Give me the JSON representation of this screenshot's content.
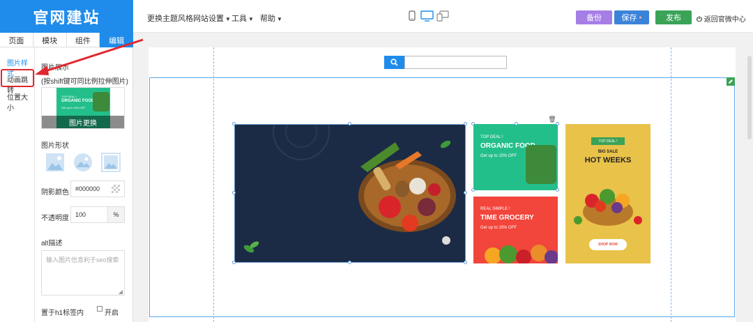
{
  "logo": "官网建站",
  "menu": {
    "theme": "更换主题风格",
    "site_settings": "网站设置",
    "tools": "工具",
    "help": "帮助"
  },
  "actions": {
    "backup": "备份",
    "save": "保存",
    "publish": "发布",
    "back": "返回官微中心"
  },
  "tabs": [
    "页面",
    "模块",
    "组件",
    "编辑"
  ],
  "left_nav": [
    "图片样式",
    "动画跳转",
    "位置大小"
  ],
  "panel": {
    "image_label": "图片展示",
    "hint": "(按shift键可同比例拉伸图片)",
    "thumb_small": "TOP DEAL !",
    "thumb_title": "ORGANIC FOOD",
    "thumb_sub": "Get up to 15% OFF",
    "replace": "图片更换",
    "shape_label": "图片形状",
    "shadow_label": "阴影颜色",
    "shadow_value": "#000000",
    "opacity_label": "不透明度",
    "opacity_value": "100",
    "opacity_unit": "%",
    "alt_label": "alt描述",
    "alt_placeholder": "输入图片信息利于seo搜索",
    "h1_label": "置于h1标签内",
    "h1_option": "开启"
  },
  "banners": {
    "green": {
      "small": "TOP DEAL !",
      "title": "ORGANIC FOOD",
      "sub": "Get up to 15% OFF"
    },
    "red": {
      "small": "REAL SIMPLE !",
      "title": "TIME GROCERY",
      "sub": "Get up to 15% OFF"
    },
    "yellow": {
      "badge": "TOP DEAL !",
      "small": "BIG SALE",
      "title": "HOT WEEKS",
      "cta": "SHOP NOW"
    }
  },
  "colors": {
    "primary": "#1f8ceb",
    "backup": "#a57ee6",
    "save": "#3b83d9",
    "publish": "#3aa357",
    "highlight": "#e0262e",
    "green_banner": "#23bf8b",
    "red_banner": "#f2453b",
    "yellow_banner": "#e9c24a",
    "navy": "#1c2b45"
  }
}
